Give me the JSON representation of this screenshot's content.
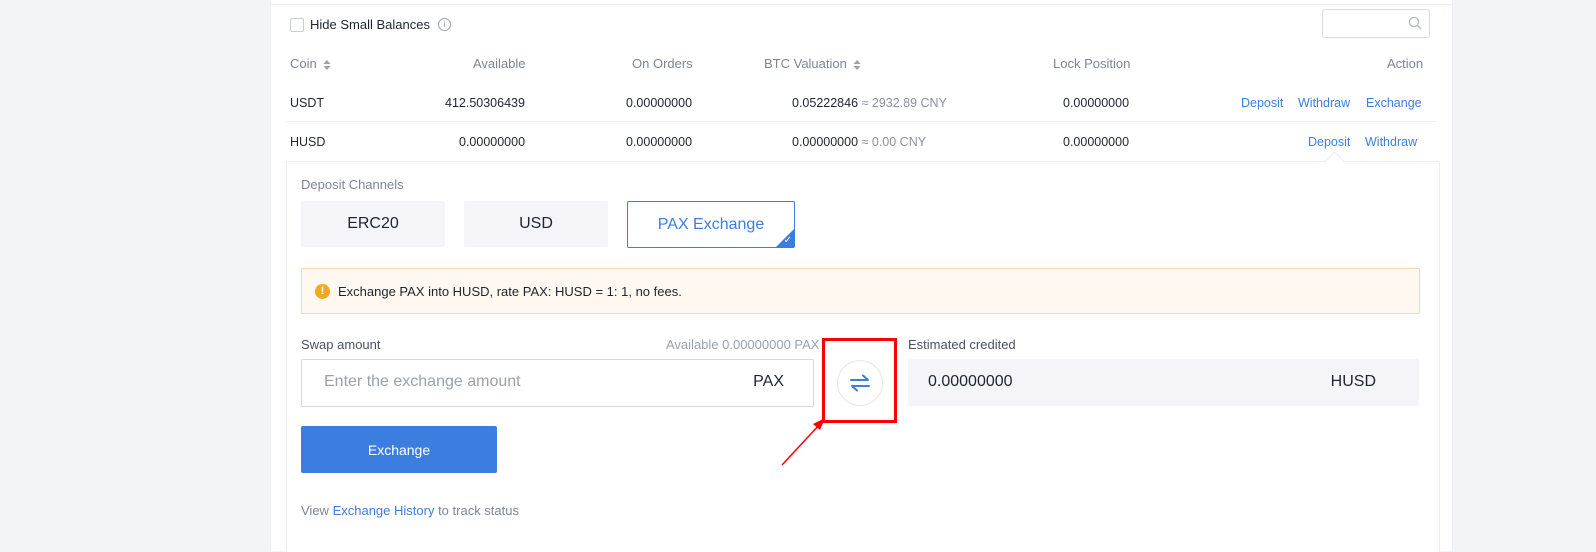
{
  "toolbar": {
    "hide_small_label": "Hide Small Balances",
    "info_icon": "i"
  },
  "table": {
    "headers": {
      "coin": "Coin",
      "available": "Available",
      "on_orders": "On Orders",
      "btc_valuation": "BTC Valuation",
      "lock_position": "Lock Position",
      "action": "Action"
    },
    "rows": [
      {
        "coin": "USDT",
        "available": "412.50306439",
        "on_orders": "0.00000000",
        "btc": "0.05222846",
        "cny": "≈ 2932.89 CNY",
        "lock": "0.00000000",
        "actions": [
          "Deposit",
          "Withdraw",
          "Exchange"
        ]
      },
      {
        "coin": "HUSD",
        "available": "0.00000000",
        "on_orders": "0.00000000",
        "btc": "0.00000000",
        "cny": "≈ 0.00 CNY",
        "lock": "0.00000000",
        "actions": [
          "Deposit",
          "Withdraw"
        ]
      }
    ]
  },
  "deposit": {
    "channels_label": "Deposit Channels",
    "channels": [
      "ERC20",
      "USD",
      "PAX Exchange"
    ],
    "selected_channel": "PAX Exchange",
    "notice": "Exchange PAX into HUSD, rate PAX: HUSD = 1: 1, no fees.",
    "swap_label": "Swap amount",
    "available_text": "Available 0.00000000 PAX",
    "swap_placeholder": "Enter the exchange amount",
    "swap_unit": "PAX",
    "estimated_label": "Estimated credited",
    "estimated_value": "0.00000000",
    "estimated_unit": "HUSD",
    "exchange_button": "Exchange",
    "history_prefix": "View ",
    "history_link": "Exchange History",
    "history_suffix": " to track status"
  },
  "colors": {
    "accent": "#3c7ee0",
    "warning": "#f5a623",
    "annotation": "#ff0000"
  }
}
